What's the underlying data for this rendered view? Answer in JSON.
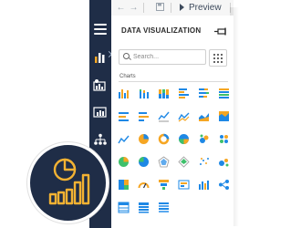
{
  "toolbar": {
    "preview_label": "Preview",
    "icons": [
      "undo-icon",
      "redo-icon",
      "save-icon",
      "play-icon"
    ]
  },
  "sidebar": {
    "items": [
      "menu-icon",
      "bar-chart-icon",
      "data-sources-icon",
      "report-icon",
      "hierarchy-icon"
    ]
  },
  "panel": {
    "title": "DATA VISUALIZATION",
    "search_placeholder": "Search...",
    "section_label": "Charts"
  },
  "chart_types": [
    "column-chart",
    "stacked-column-chart",
    "100-stacked-column-chart",
    "bar-chart",
    "stacked-bar-chart",
    "100-stacked-bar-chart",
    "line-chart",
    "area-chart",
    "stacked-area-chart",
    "spline-chart",
    "step-area-chart",
    "area-100-chart",
    "trend-line-chart",
    "pie-chart",
    "doughnut-chart",
    "semi-pie-chart",
    "funnel-like-chart",
    "sunburst-chart",
    "scatter-chart",
    "pyramid-pie-chart",
    "radar-chart",
    "polar-chart",
    "bubble-chart",
    "heatmap-chart",
    "treemap-chart",
    "gauge-chart",
    "funnel-chart",
    "kpi-chart",
    "range-bar-chart",
    "sankey-chart",
    "table-chart",
    "grid-chart",
    "pivot-chart"
  ],
  "colors": {
    "sidebar": "#1f2d47",
    "accent_blue": "#1e88e5",
    "accent_orange": "#f5a623",
    "accent_green": "#3ec06b",
    "badge_stroke": "#f2b233"
  }
}
